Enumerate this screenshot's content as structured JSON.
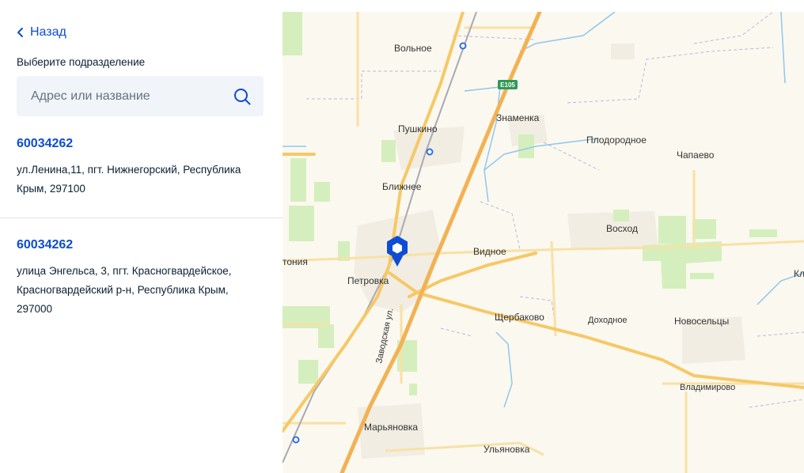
{
  "nav": {
    "back_label": "Назад"
  },
  "panel": {
    "subtitle": "Выберите подразделение",
    "search": {
      "placeholder": "Адрес или название",
      "value": ""
    }
  },
  "offices": [
    {
      "code": "60034262",
      "address": "ул.Ленина,11, пгт. Нижнегорский, Республика Крым, 297100"
    },
    {
      "code": "60034262",
      "address": "улица Энгельса, 3, пгт. Красногвардейское, Красногвардейский р-н, Республика Крым, 297000"
    }
  ],
  "map": {
    "road_shield": "E105",
    "street_label": "Заводская ул.",
    "places": [
      "Вольное",
      "Знаменка",
      "Пушкино",
      "Плодородное",
      "Чапаево",
      "Ближнее",
      "Восход",
      "Видное",
      "тония",
      "Петровка",
      "Кл",
      "Щербаково",
      "Доходное",
      "Новосельцы",
      "Владимирово",
      "Марьяновка",
      "Ульяновка"
    ]
  },
  "colors": {
    "accent": "#0d4cd3",
    "marker": "#0d4cd3",
    "map_background": "#fbf8ef",
    "major_road": "#f6c866",
    "minor_road": "#f7e1a6",
    "green_area": "#d4efbd",
    "water": "#8fc7ee",
    "settlement": "#f1ede3"
  },
  "icons": {
    "back": "chevron-left-icon",
    "search": "search-icon",
    "marker": "map-marker-icon"
  }
}
